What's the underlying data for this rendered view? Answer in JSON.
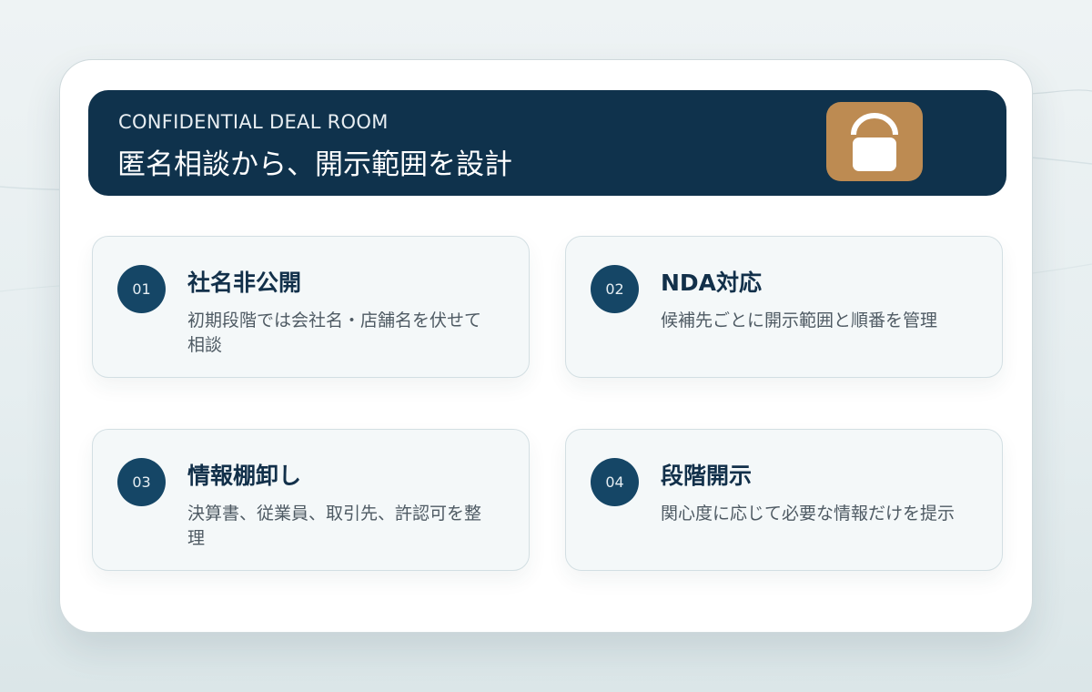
{
  "header": {
    "kicker": "CONFIDENTIAL DEAL ROOM",
    "title": "匿名相談から、開示範囲を設計",
    "icon": "lock-icon"
  },
  "features": [
    {
      "number": "01",
      "title": "社名非公開",
      "description": "初期段階では会社名・店舗名を伏せて相談"
    },
    {
      "number": "02",
      "title": "NDA対応",
      "description": "候補先ごとに開示範囲と順番を管理"
    },
    {
      "number": "03",
      "title": "情報棚卸し",
      "description": "決算書、従業員、取引先、許認可を整理"
    },
    {
      "number": "04",
      "title": "段階開示",
      "description": "関心度に応じて必要な情報だけを提示"
    }
  ],
  "colors": {
    "header_bg": "#0f324c",
    "accent_gold": "#bd8b52",
    "number_badge": "#154666",
    "card_bg": "#f4f8f9"
  }
}
